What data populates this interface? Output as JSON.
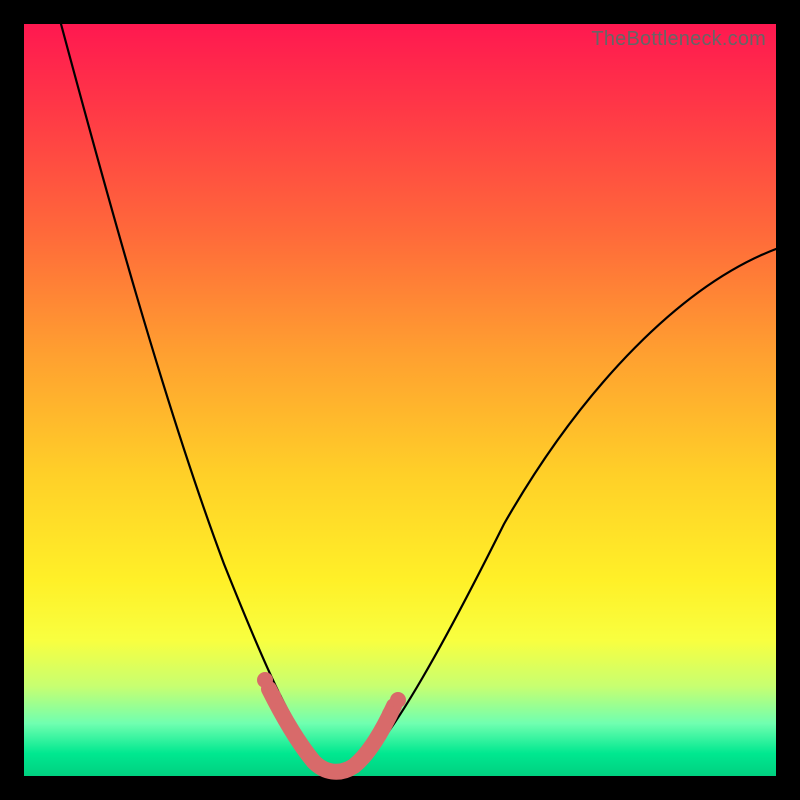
{
  "watermark": "TheBottleneck.com",
  "accent_colors": {
    "curve": "#000000",
    "marker": "#d86a6a",
    "gradient_top": "#ff1850",
    "gradient_bottom": "#00d080"
  },
  "chart_data": {
    "type": "line",
    "title": "",
    "xlabel": "",
    "ylabel": "",
    "xlim": [
      0,
      100
    ],
    "ylim": [
      0,
      100
    ],
    "grid": false,
    "legend": false,
    "annotations": [
      "TheBottleneck.com"
    ],
    "series": [
      {
        "name": "bottleneck-curve",
        "x": [
          5,
          10,
          15,
          20,
          25,
          28,
          31,
          34,
          36,
          37,
          38,
          40,
          42,
          44,
          46,
          50,
          55,
          60,
          65,
          70,
          75,
          80,
          85,
          90,
          95,
          100
        ],
        "values": [
          100,
          85,
          70,
          55,
          40,
          30,
          20,
          12,
          6,
          3,
          1,
          0,
          0,
          1,
          3,
          8,
          15,
          22,
          29,
          36,
          43,
          49,
          55,
          60,
          65,
          70
        ]
      }
    ],
    "optimum_marker": {
      "x_range": [
        34,
        46
      ],
      "value": 0,
      "note": "highlighted minimum region along curve"
    },
    "background": "rainbow vertical gradient red→orange→yellow→green"
  }
}
